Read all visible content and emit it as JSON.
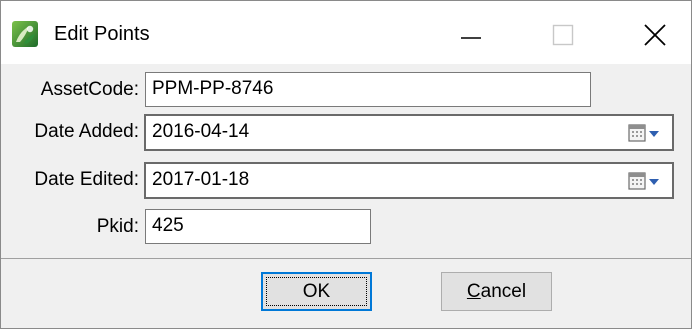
{
  "window": {
    "title": "Edit Points",
    "icon": "app-logo-icon",
    "controls": [
      "minimize-icon",
      "maximize-icon",
      "close-icon"
    ]
  },
  "form": {
    "asset_code": {
      "label": "AssetCode:",
      "value": "PPM-PP-8746"
    },
    "date_added": {
      "label": "Date Added:",
      "value": "2016-04-14",
      "button_icon": "calendar-dropdown-icon"
    },
    "date_edited": {
      "label": "Date Edited:",
      "value": "2017-01-18",
      "button_icon": "calendar-dropdown-icon"
    },
    "pkid": {
      "label": "Pkid:",
      "value": "425"
    }
  },
  "buttons": {
    "ok_label": "OK",
    "cancel_label": "Cancel",
    "cancel_mnemonic": "C"
  },
  "colors": {
    "default_button_border": "#0078d7",
    "dialog_background": "#f0f0f0",
    "titlebar_background": "#ffffff"
  }
}
